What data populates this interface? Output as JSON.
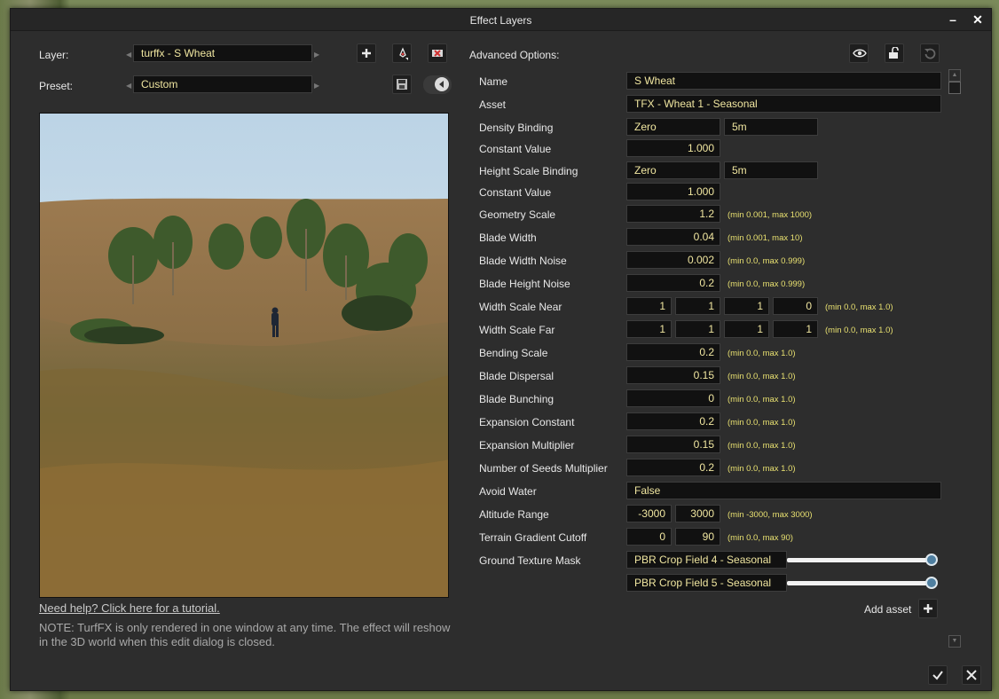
{
  "window": {
    "title": "Effect Layers"
  },
  "layer": {
    "label": "Layer:",
    "value": "turffx - S Wheat"
  },
  "preset": {
    "label": "Preset:",
    "value": "Custom"
  },
  "advanced": {
    "label": "Advanced Options:"
  },
  "rows": {
    "name": {
      "label": "Name",
      "value": "S Wheat"
    },
    "asset": {
      "label": "Asset",
      "value": "TFX - Wheat 1 - Seasonal"
    },
    "density_binding": {
      "label": "Density Binding",
      "value1": "Zero",
      "value2": "5m"
    },
    "constant_value_1": {
      "label": "Constant Value",
      "value": "1.000"
    },
    "height_scale_binding": {
      "label": "Height Scale Binding",
      "value1": "Zero",
      "value2": "5m"
    },
    "constant_value_2": {
      "label": "Constant Value",
      "value": "1.000"
    },
    "geometry_scale": {
      "label": "Geometry Scale",
      "value": "1.2",
      "hint": "(min 0.001, max 1000)"
    },
    "blade_width": {
      "label": "Blade Width",
      "value": "0.04",
      "hint": "(min 0.001, max 10)"
    },
    "blade_width_noise": {
      "label": "Blade Width Noise",
      "value": "0.002",
      "hint": "(min 0.0, max 0.999)"
    },
    "blade_height_noise": {
      "label": "Blade Height Noise",
      "value": "0.2",
      "hint": "(min 0.0, max 0.999)"
    },
    "width_scale_near": {
      "label": "Width Scale Near",
      "values": [
        "1",
        "1",
        "1",
        "0"
      ],
      "hint": "(min 0.0, max 1.0)"
    },
    "width_scale_far": {
      "label": "Width Scale Far",
      "values": [
        "1",
        "1",
        "1",
        "1"
      ],
      "hint": "(min 0.0, max 1.0)"
    },
    "bending_scale": {
      "label": "Bending Scale",
      "value": "0.2",
      "hint": "(min 0.0, max 1.0)"
    },
    "blade_dispersal": {
      "label": "Blade Dispersal",
      "value": "0.15",
      "hint": "(min 0.0, max 1.0)"
    },
    "blade_bunching": {
      "label": "Blade Bunching",
      "value": "0",
      "hint": "(min 0.0, max 1.0)"
    },
    "expansion_constant": {
      "label": "Expansion Constant",
      "value": "0.2",
      "hint": "(min 0.0, max 1.0)"
    },
    "expansion_multiplier": {
      "label": "Expansion Multiplier",
      "value": "0.15",
      "hint": "(min 0.0, max 1.0)"
    },
    "seeds_multiplier": {
      "label": "Number of Seeds Multiplier",
      "value": "0.2",
      "hint": "(min 0.0, max 1.0)"
    },
    "avoid_water": {
      "label": "Avoid Water",
      "value": "False"
    },
    "altitude_range": {
      "label": "Altitude Range",
      "min": "-3000",
      "max": "3000",
      "hint": "(min -3000, max 3000)"
    },
    "terrain_gradient": {
      "label": "Terrain Gradient Cutoff",
      "min": "0",
      "max": "90",
      "hint": "(min 0.0, max 90)"
    },
    "ground_texture_mask": {
      "label": "Ground Texture Mask",
      "items": [
        {
          "name": "PBR Crop Field 4 - Seasonal",
          "level": 1.0
        },
        {
          "name": "PBR Crop Field 5 - Seasonal",
          "level": 1.0
        }
      ]
    }
  },
  "add_asset": {
    "label": "Add asset"
  },
  "help": {
    "link": "Need help? Click here for a tutorial.",
    "note": "NOTE: TurfFX is only rendered in one window at any time. The effect will reshow in the 3D world when this edit dialog is closed."
  },
  "colors": {
    "field_text": "#f0e6a0",
    "hint_text": "#e8e070",
    "knob": "#4f7fa0",
    "delete_icon": "#d03030"
  }
}
